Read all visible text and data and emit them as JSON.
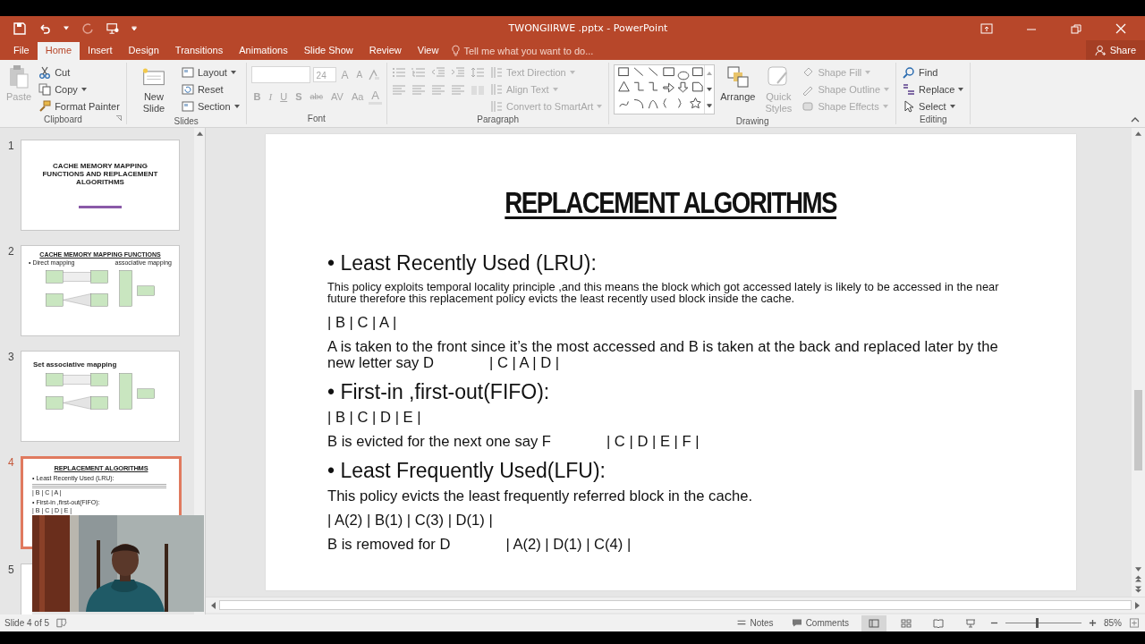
{
  "window": {
    "title": "TWONGIIRWE .pptx - PowerPoint"
  },
  "tabs": [
    {
      "label": "File",
      "selected": false
    },
    {
      "label": "Home",
      "selected": true
    },
    {
      "label": "Insert",
      "selected": false
    },
    {
      "label": "Design",
      "selected": false
    },
    {
      "label": "Transitions",
      "selected": false
    },
    {
      "label": "Animations",
      "selected": false
    },
    {
      "label": "Slide Show",
      "selected": false
    },
    {
      "label": "Review",
      "selected": false
    },
    {
      "label": "View",
      "selected": false
    }
  ],
  "tell_me": {
    "placeholder": "Tell me what you want to do..."
  },
  "share": "Share",
  "ribbon": {
    "clipboard": {
      "label": "Clipboard",
      "paste": {
        "label": "Paste",
        "disabled": true
      },
      "commands": [
        {
          "label": "Cut",
          "disabled": false
        },
        {
          "label": "Copy",
          "disabled": false
        },
        {
          "label": "Format Painter",
          "disabled": false
        }
      ]
    },
    "slides": {
      "label": "Slides",
      "new_slide": "New Slide",
      "commands": [
        {
          "label": "Layout"
        },
        {
          "label": "Reset"
        },
        {
          "label": "Section"
        }
      ]
    },
    "font": {
      "label": "Font",
      "disabled": true,
      "size": "24",
      "size_buttons": [
        "A",
        "A"
      ],
      "format_buttons": [
        "B",
        "I",
        "U",
        "S",
        "abc",
        "AV",
        "Aa"
      ],
      "color_button": "A"
    },
    "paragraph": {
      "label": "Paragraph",
      "disabled": true,
      "commands": [
        {
          "label": "Text Direction"
        },
        {
          "label": "Align Text"
        },
        {
          "label": "Convert to SmartArt"
        }
      ]
    },
    "drawing": {
      "label": "Drawing",
      "arrange": {
        "label": "Arrange",
        "disabled": false
      },
      "quick_styles": {
        "label": "Quick Styles",
        "disabled": true
      },
      "commands": [
        {
          "label": "Shape Fill",
          "disabled": true
        },
        {
          "label": "Shape Outline",
          "disabled": true
        },
        {
          "label": "Shape Effects",
          "disabled": true
        }
      ]
    },
    "editing": {
      "label": "Editing",
      "commands": [
        {
          "label": "Find"
        },
        {
          "label": "Replace"
        },
        {
          "label": "Select"
        }
      ]
    }
  },
  "slides": [
    {
      "number": "1",
      "selected": false,
      "kind": "title",
      "title": "CACHE MEMORY MAPPING FUNCTIONS  AND REPLACEMENT ALGORITHMS"
    },
    {
      "number": "2",
      "selected": false,
      "kind": "diagram",
      "title": "CACHE MEMORY MAPPING FUNCTIONS",
      "labels": [
        "• Direct mapping",
        "associative mapping"
      ]
    },
    {
      "number": "3",
      "selected": false,
      "kind": "diagram",
      "title": "Set associative mapping"
    },
    {
      "number": "4",
      "selected": true,
      "kind": "text",
      "title": "REPLACEMENT ALGORITHMS",
      "lines": [
        "• Least Recently Used (LRU):",
        "| B | C | A |",
        "• First-in ,first-out(FIFO):",
        "| B | C | D | E |"
      ]
    },
    {
      "number": "5",
      "selected": false,
      "kind": "blank"
    }
  ],
  "slide": {
    "title": "REPLACEMENT ALGORITHMS",
    "blocks": [
      {
        "kind": "bullet",
        "text": "• Least Recently Used (LRU):"
      },
      {
        "kind": "small",
        "text": "This policy exploits temporal locality principle ,and this means the block which got accessed lately is likely to be accessed in the near future therefore this replacement policy evicts the least recently used block inside the cache."
      },
      {
        "kind": "text",
        "text": "| B | C | A |"
      },
      {
        "kind": "text",
        "text": "A is taken to the front since it’s the most accessed and B is taken at the back and replaced later by the new letter say D",
        "aside": "| C | A | D |"
      },
      {
        "kind": "bullet",
        "text": "• First-in ,first-out(FIFO):"
      },
      {
        "kind": "text",
        "text": "| B | C | D | E |"
      },
      {
        "kind": "text",
        "text": "B is evicted for the next one say F",
        "aside": "| C | D | E | F |"
      },
      {
        "kind": "bullet",
        "text": "• Least Frequently Used(LFU):"
      },
      {
        "kind": "text",
        "text": "This policy evicts the least frequently referred block in the cache."
      },
      {
        "kind": "text",
        "text": "| A(2) | B(1) | C(3) | D(1) |"
      },
      {
        "kind": "text",
        "text": "B is removed for D",
        "aside": "| A(2) | D(1) | C(4) |"
      }
    ]
  },
  "status_bar": {
    "slide_info": "Slide 4 of 5",
    "notes": "Notes",
    "comments": "Comments",
    "zoom": {
      "level": 0.41,
      "reading": "85%"
    }
  }
}
